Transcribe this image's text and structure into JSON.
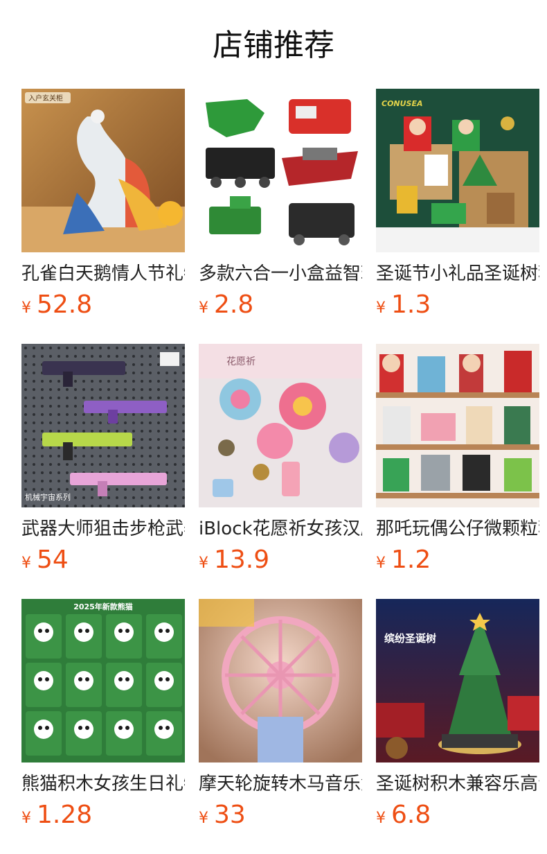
{
  "header": {
    "title": "店铺推荐"
  },
  "currency_symbol": "¥",
  "products": [
    {
      "name": "孔雀白天鹅情人节礼物",
      "price": "52.8",
      "image": "peacock-block-sculpture",
      "badge": "入户玄关柜"
    },
    {
      "name": "多款六合一小盒益智玩具",
      "price": "2.8",
      "image": "six-in-one-vehicles"
    },
    {
      "name": "圣诞节小礼品圣诞树积木",
      "price": "1.3",
      "image": "christmas-mini-figures",
      "badge": "CONUSEA"
    },
    {
      "name": "武器大师狙击步枪武器",
      "price": "54",
      "image": "weapon-blocks-pegboard",
      "badge": "机械宇宙系列"
    },
    {
      "name": "iBlock花愿祈女孩汉服",
      "price": "13.9",
      "image": "flower-wind-chimes",
      "badge": "花愿祈"
    },
    {
      "name": "那吒玩偶公仔微颗粒积木",
      "price": "1.2",
      "image": "nezha-mini-figures"
    },
    {
      "name": "熊猫积木女孩生日礼物",
      "price": "1.28",
      "image": "panda-block-set",
      "badge": "2025年新款熊猫"
    },
    {
      "name": "摩天轮旋转木马音乐盒",
      "price": "33",
      "image": "ferris-wheel-music-box"
    },
    {
      "name": "圣诞树积木兼容乐高音乐盒",
      "price": "6.8",
      "image": "christmas-tree-music-box",
      "badge": "缤纷圣诞树"
    }
  ],
  "colors": {
    "price": "#ee4e13",
    "title": "#111111"
  }
}
